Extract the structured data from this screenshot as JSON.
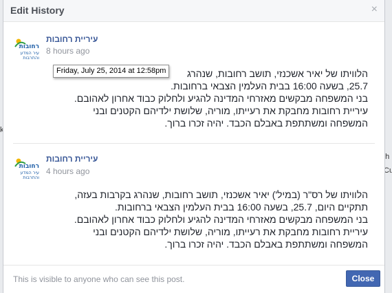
{
  "dialog": {
    "title": "Edit History",
    "close_icon": "×",
    "footer_text": "This is visible to anyone who can see this post.",
    "close_button_label": "Close"
  },
  "background": {
    "left_fragment": "k",
    "right_fragment_1": "'h",
    "right_fragment_2": "Cu"
  },
  "entries": [
    {
      "author": "עיריית רחובות",
      "time": "8 hours ago",
      "tooltip": "Friday, July 25, 2014 at 12:58pm",
      "lines": [
        "הלוויתו של יאיר אשכנזי, תושב רחובות, שנהרג",
        "25.7, בשעה 16:00 בבית העלמין הצבאי ברחובות.",
        "בני המשפחה מבקשים מאזרחי המדינה להגיע ולחלוק כבוד אחרון לאהובם.",
        "עיריית רחובות מחבקת את רעייתו, מוריה, שלושת ילדיהם הקטנים ובני",
        "המשפחה ומשתתפת באבלם הכבד. יהיה זכרו ברוך."
      ]
    },
    {
      "author": "עיריית רחובות",
      "time": "4 hours ago",
      "lines": [
        "הלוויתו של רס\"ר (במיל') יאיר אשכנזי, תושב רחובות, שנהרג בקרבות בעזה,",
        "תתקיים היום, 25.7, בשעה 16:00 בבית העלמין הצבאי ברחובות.",
        "בני המשפחה מבקשים מאזרחי המדינה להגיע ולחלוק כבוד אחרון לאהובם.",
        "עיריית רחובות מחבקת את רעייתו, מוריה, שלושת ילדיהם הקטנים ובני",
        "המשפחה ומשתתפת באבלם הכבד. יהיה זכרו ברוך."
      ]
    }
  ],
  "logo": {
    "text_line_1": "רחובות",
    "text_line_2": "עיר המדע",
    "text_line_3": "והתרבות",
    "colors": {
      "primary": "#1f5fa8",
      "accent": "#2f9e44"
    }
  },
  "colors": {
    "link": "#3b5998",
    "button": "#4267b2",
    "muted": "#90949c"
  }
}
